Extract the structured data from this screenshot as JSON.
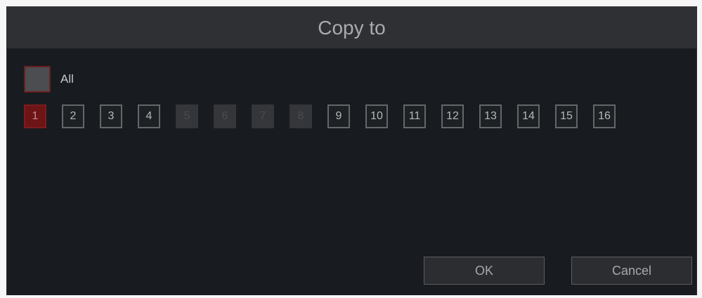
{
  "dialog": {
    "title": "Copy to"
  },
  "all": {
    "label": "All",
    "checked": false
  },
  "channels": [
    {
      "label": "1",
      "state": "selected"
    },
    {
      "label": "2",
      "state": "normal"
    },
    {
      "label": "3",
      "state": "normal"
    },
    {
      "label": "4",
      "state": "normal"
    },
    {
      "label": "5",
      "state": "disabled"
    },
    {
      "label": "6",
      "state": "disabled"
    },
    {
      "label": "7",
      "state": "disabled"
    },
    {
      "label": "8",
      "state": "disabled"
    },
    {
      "label": "9",
      "state": "normal"
    },
    {
      "label": "10",
      "state": "normal"
    },
    {
      "label": "11",
      "state": "normal"
    },
    {
      "label": "12",
      "state": "normal"
    },
    {
      "label": "13",
      "state": "normal"
    },
    {
      "label": "14",
      "state": "normal"
    },
    {
      "label": "15",
      "state": "normal"
    },
    {
      "label": "16",
      "state": "normal"
    }
  ],
  "buttons": {
    "ok": "OK",
    "cancel": "Cancel"
  },
  "colors": {
    "dialog_bg": "#181b1f",
    "titlebar_bg": "#2e3034",
    "selected": "#6d1416",
    "disabled": "#343639",
    "border": "#64666a"
  }
}
